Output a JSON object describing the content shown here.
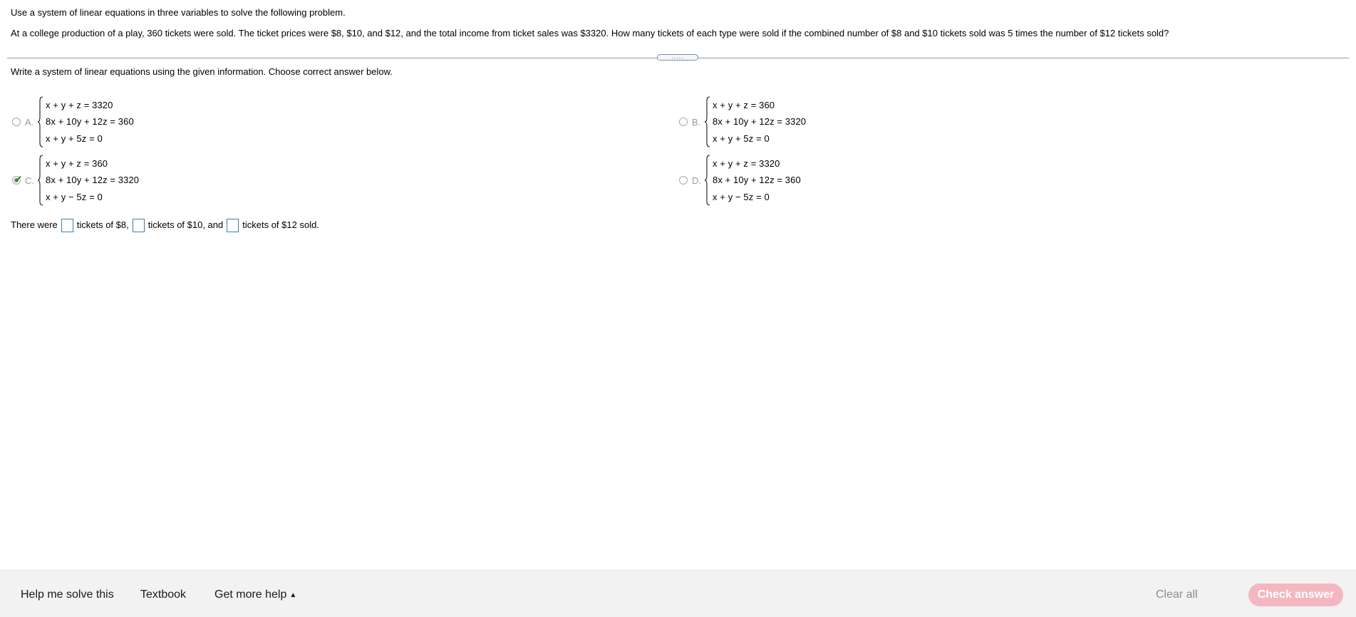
{
  "question": {
    "instructions": "Use a system of linear equations in three variables to solve the following problem.",
    "problem": "At a college production of a play, 360 tickets were sold. The ticket prices were $8, $10, and $12, and the total income from ticket sales was $3320. How many tickets of each type were sold if the combined number of $8 and $10 tickets sold was 5 times the number of $12 tickets sold?",
    "divider_handle": ".....",
    "prompt": "Write a system of linear equations using the given information. Choose correct answer below."
  },
  "options": [
    {
      "letter": "A.",
      "selected": false,
      "equations": [
        "x + y + z = 3320",
        "8x + 10y + 12z = 360",
        "x + y + 5z = 0"
      ]
    },
    {
      "letter": "B.",
      "selected": false,
      "equations": [
        "x + y + z = 360",
        "8x + 10y + 12z = 3320",
        "x + y + 5z = 0"
      ]
    },
    {
      "letter": "C.",
      "selected": true,
      "equations": [
        "x + y + z = 360",
        "8x + 10y + 12z = 3320",
        "x + y − 5z = 0"
      ]
    },
    {
      "letter": "D.",
      "selected": false,
      "equations": [
        "x + y + z = 3320",
        "8x + 10y + 12z = 360",
        "x + y − 5z = 0"
      ]
    }
  ],
  "answer_line": {
    "part1": "There were",
    "part2": "tickets of $8,",
    "part3": "tickets of $10, and",
    "part4": "tickets of $12 sold.",
    "box1_value": "",
    "box2_value": "",
    "box3_value": ""
  },
  "footer": {
    "help_me_solve": "Help me solve this",
    "textbook": "Textbook",
    "get_more_help": "Get more help",
    "clear_all": "Clear all",
    "check_answer": "Check answer"
  },
  "colors": {
    "check_answer_bg": "#f4b7c0",
    "answer_box_border": "#3e7fae",
    "checkmark": "#2e8b2e",
    "footer_bg": "#f2f2f2"
  }
}
